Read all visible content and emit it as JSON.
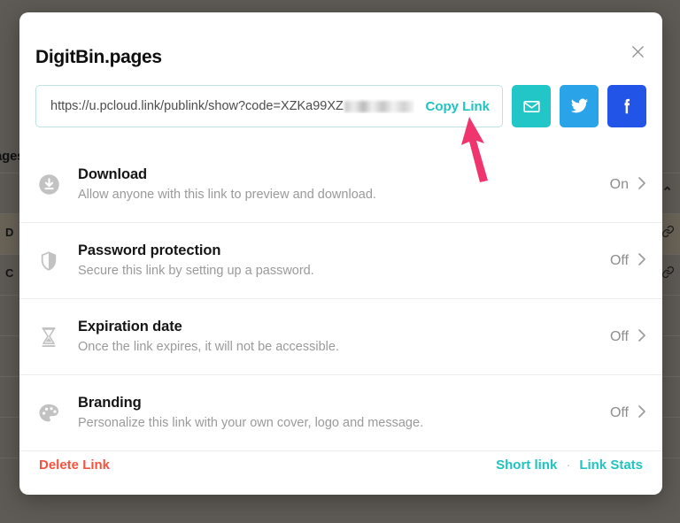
{
  "background": {
    "partial_title": "ages",
    "rows": [
      {
        "label": "D",
        "icon": "link-icon"
      },
      {
        "label": "C",
        "icon": "link-icon"
      }
    ],
    "caret": "⌃"
  },
  "modal": {
    "title": "DigitBin.pages",
    "close_icon": "close-icon",
    "link": {
      "url_visible": "https://u.pcloud.link/publink/show?code=XZKa99XZ",
      "redacted": true,
      "copy_label": "Copy Link"
    },
    "share_buttons": [
      {
        "name": "email",
        "icon": "envelope-icon",
        "color": "#22c6c6"
      },
      {
        "name": "twitter",
        "icon": "twitter-bird-icon",
        "color": "#2ba3e8"
      },
      {
        "name": "facebook",
        "icon": "facebook-f-icon",
        "color": "#2254e8"
      }
    ],
    "options": [
      {
        "id": "download",
        "icon": "download-circle-icon",
        "title": "Download",
        "description": "Allow anyone with this link to preview and download.",
        "state": "On"
      },
      {
        "id": "password-protection",
        "icon": "shield-icon",
        "title": "Password protection",
        "description": "Secure this link by setting up a password.",
        "state": "Off"
      },
      {
        "id": "expiration-date",
        "icon": "hourglass-icon",
        "title": "Expiration date",
        "description": "Once the link expires, it will not be accessible.",
        "state": "Off"
      },
      {
        "id": "branding",
        "icon": "palette-icon",
        "title": "Branding",
        "description": "Personalize this link with your own cover, logo and message.",
        "state": "Off"
      }
    ],
    "footer": {
      "delete_label": "Delete Link",
      "short_link_label": "Short link",
      "separator": "·",
      "link_stats_label": "Link Stats"
    }
  },
  "annotation": {
    "arrow_icon": "arrow-pointer-icon",
    "arrow_color": "#f0356e"
  },
  "colors": {
    "accent_teal": "#1fc3c0",
    "danger_red": "#f4533f",
    "annotation_pink": "#f0356e",
    "modal_bg": "#ffffff",
    "backdrop": "#5e5a55"
  }
}
